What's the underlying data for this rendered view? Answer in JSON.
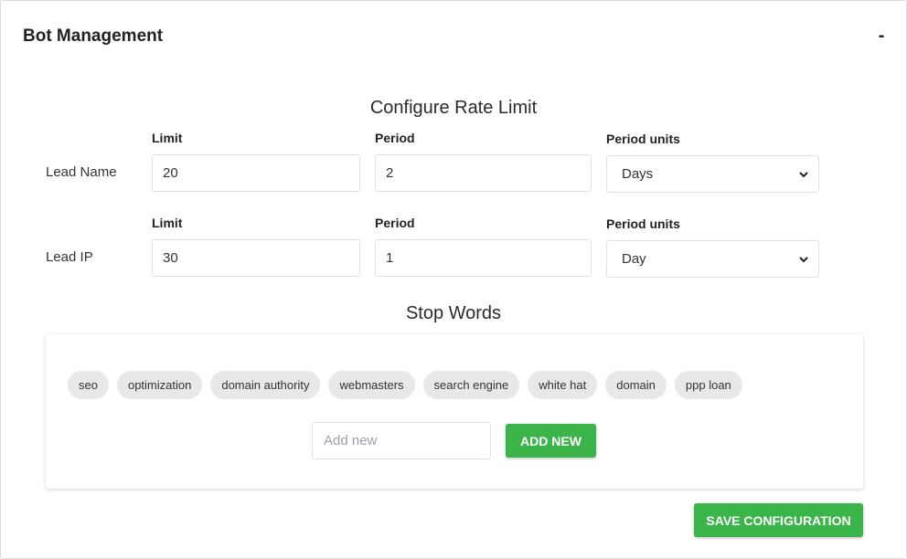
{
  "header": {
    "title": "Bot Management",
    "collapse_label": "-"
  },
  "rate_limit": {
    "title": "Configure Rate Limit",
    "rows": [
      {
        "label": "Lead Name",
        "limit_label": "Limit",
        "limit_value": "20",
        "period_label": "Period",
        "period_value": "2",
        "units_label": "Period units",
        "units_value": "Days"
      },
      {
        "label": "Lead IP",
        "limit_label": "Limit",
        "limit_value": "30",
        "period_label": "Period",
        "period_value": "1",
        "units_label": "Period units",
        "units_value": "Day"
      }
    ]
  },
  "stop_words": {
    "title": "Stop Words",
    "chips": [
      "seo",
      "optimization",
      "domain authority",
      "webmasters",
      "search engine",
      "white hat",
      "domain",
      "ppp loan"
    ],
    "add_placeholder": "Add new",
    "add_value": "",
    "add_button": "ADD NEW"
  },
  "footer": {
    "save_button": "SAVE CONFIGURATION"
  },
  "colors": {
    "accent_green": "#3bb54a",
    "chip_bg": "#e8e8e8"
  }
}
